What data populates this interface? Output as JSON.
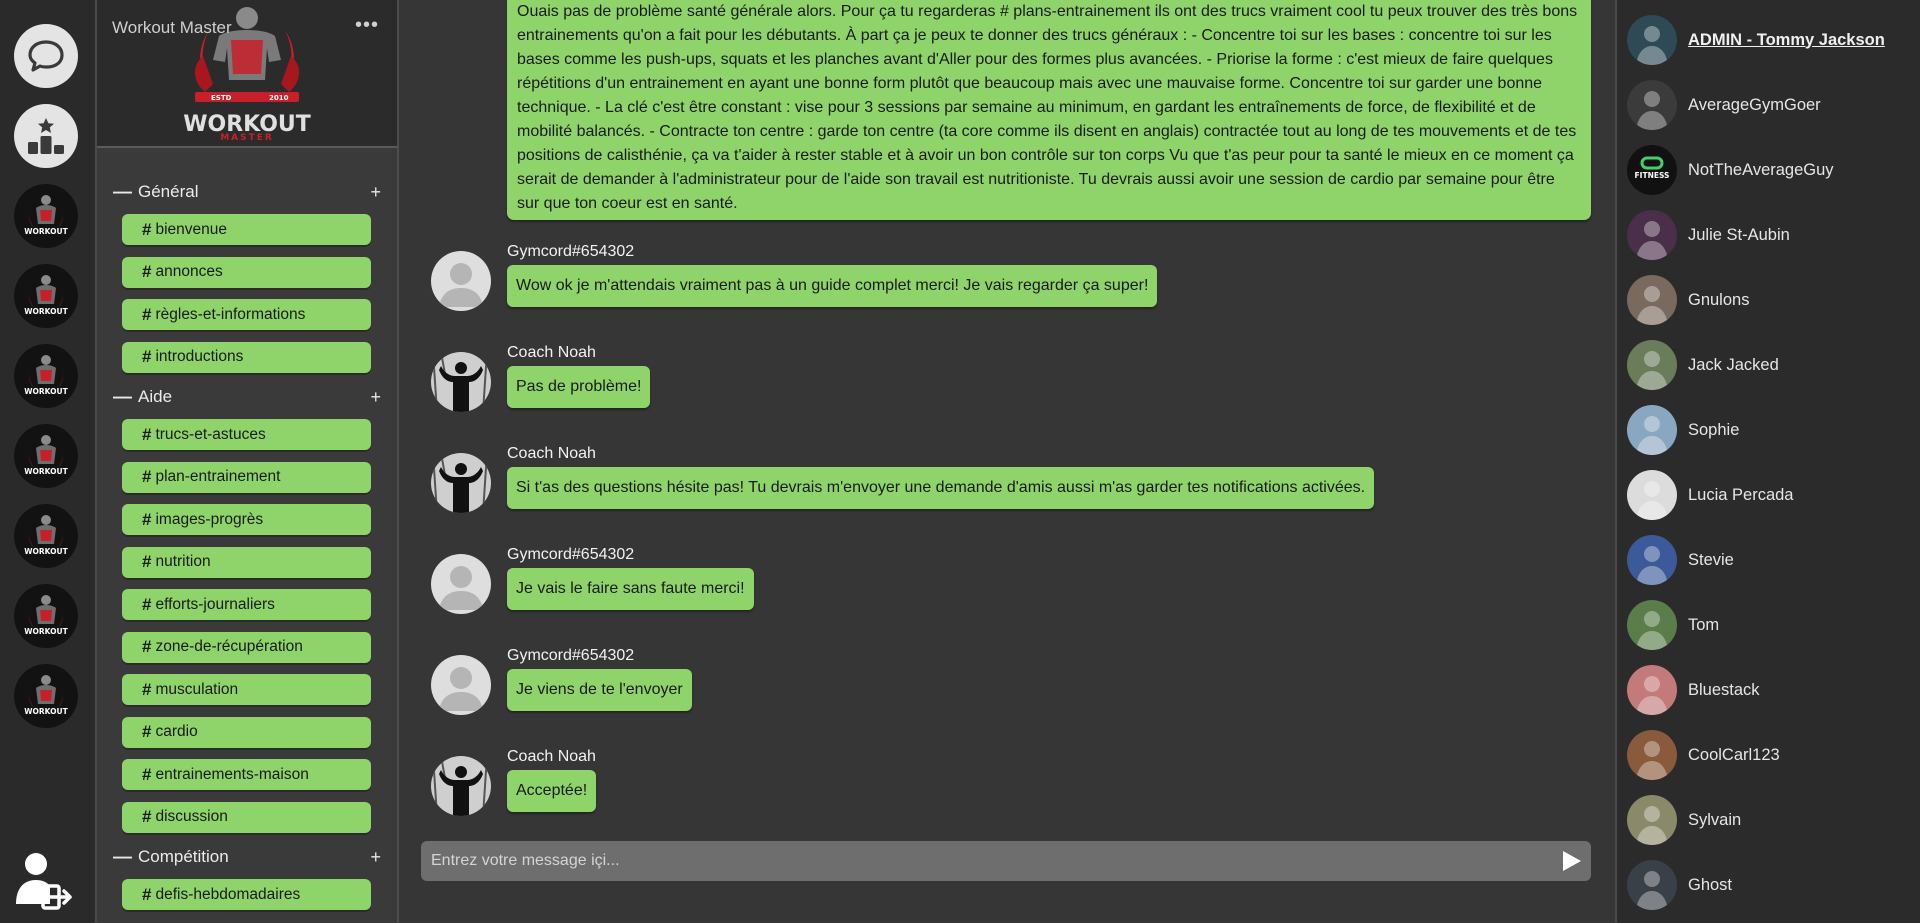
{
  "server": {
    "name": "Workout Master",
    "menu_label": "•••",
    "logo_text": "WORKOUT",
    "logo_subtext": "MASTER",
    "logo_est": "ESTD",
    "logo_year": "2010"
  },
  "rail": {
    "server_logo_text": "WORKOUT",
    "server_count": 7
  },
  "categories": [
    {
      "name": "Général",
      "collapse": "—",
      "add": "+",
      "channels": [
        "bienvenue",
        "annonces",
        "règles-et-informations",
        "introductions"
      ]
    },
    {
      "name": "Aide",
      "collapse": "—",
      "add": "+",
      "channels": [
        "trucs-et-astuces",
        "plan-entrainement",
        "images-progrès",
        "nutrition",
        "efforts-journaliers",
        "zone-de-récupération",
        "musculation",
        "cardio",
        "entrainements-maison",
        "discussion"
      ]
    },
    {
      "name": "Compétition",
      "collapse": "—",
      "add": "+",
      "channels": [
        "defis-hebdomadaires"
      ]
    }
  ],
  "hash_symbol": "#",
  "chat": {
    "first_message": "Ouais pas de problème santé générale alors. Pour ça tu regarderas # plans-entrainement ils ont des trucs vraiment cool tu peux trouver des très bons entrainements qu'on a fait pour les débutants. À part ça je peux te donner des trucs généraux : - Concentre toi sur les bases : concentre toi sur les bases comme les push-ups, squats et les planches avant d'Aller pour des formes plus avancées. - Priorise la forme : c'est mieux de faire quelques répétitions d'un entrainement en ayant une bonne form plutôt que beaucoup mais avec une mauvaise forme. Concentre toi sur garder une bonne technique. - La clé c'est être constant : vise pour 3 sessions par semaine au minimum, en gardant les entraînements de force, de flexibilité et de mobilité balancés. - Contracte ton centre : garde ton centre (ta core comme ils disent en anglais) contractée tout au long de tes mouvements et de tes positions de calisthénie, ça va t'aider à rester stable et à avoir un bon contrôle sur ton corps Vu que t'as peur pour ta santé le mieux en ce moment ça serait de demander à l'administrateur pour de l'aide son travail est nutritioniste. Tu devrais aussi avoir une session de cardio par semaine pour être sur que ton coeur est en santé.",
    "messages": [
      {
        "author": "Gymcord#654302",
        "text": "Wow ok je m'attendais vraiment pas à un guide complet merci! Je vais regarder ça super!",
        "avatar": "default"
      },
      {
        "author": "Coach Noah",
        "text": "Pas de problème!",
        "avatar": "coach"
      },
      {
        "author": "Coach Noah",
        "text": "Si t'as des questions hésite pas! Tu devrais m'envoyer une demande d'amis aussi m'as garder tes notifications activées.",
        "avatar": "coach"
      },
      {
        "author": "Gymcord#654302",
        "text": "Je vais le faire sans faute merci!",
        "avatar": "default"
      },
      {
        "author": "Gymcord#654302",
        "text": "Je viens de te l'envoyer",
        "avatar": "default"
      },
      {
        "author": "Coach Noah",
        "text": "Acceptée!",
        "avatar": "coach"
      }
    ],
    "input_placeholder": "Entrez votre message içi..."
  },
  "members": [
    {
      "name": "ADMIN - Tommy Jackson",
      "admin": true,
      "color": "#2d4a55"
    },
    {
      "name": "AverageGymGoer",
      "admin": false,
      "color": "#3b3b3b"
    },
    {
      "name": "NotTheAverageGuy",
      "admin": false,
      "color": "#111111",
      "badge": "FITNESS"
    },
    {
      "name": "Julie St-Aubin",
      "admin": false,
      "color": "#4a2f4a"
    },
    {
      "name": "Gnulons",
      "admin": false,
      "color": "#7a6a5e"
    },
    {
      "name": "Jack Jacked",
      "admin": false,
      "color": "#6b7c5a"
    },
    {
      "name": "Sophie",
      "admin": false,
      "color": "#8aa7c2"
    },
    {
      "name": "Lucia Percada",
      "admin": false,
      "color": "#dcdcdc"
    },
    {
      "name": "Stevie",
      "admin": false,
      "color": "#3c5a9a"
    },
    {
      "name": "Tom",
      "admin": false,
      "color": "#5a7d4a"
    },
    {
      "name": "Bluestack",
      "admin": false,
      "color": "#c27a7a"
    },
    {
      "name": "CoolCarl123",
      "admin": false,
      "color": "#8a5a3c"
    },
    {
      "name": "Sylvain",
      "admin": false,
      "color": "#8a8a6a"
    },
    {
      "name": "Ghost",
      "admin": false,
      "color": "#3a4048"
    }
  ],
  "colors": {
    "accent_green": "#8fd46a",
    "background": "#363636",
    "sidebar": "#3a3a3a",
    "rail": "#2a2a2a",
    "brand_red": "#c8202a"
  },
  "icons": {
    "chat": "chat-bubble-icon",
    "leaderboard": "leaderboard-icon",
    "logout": "user-logout-icon",
    "send": "send-arrow-icon"
  }
}
